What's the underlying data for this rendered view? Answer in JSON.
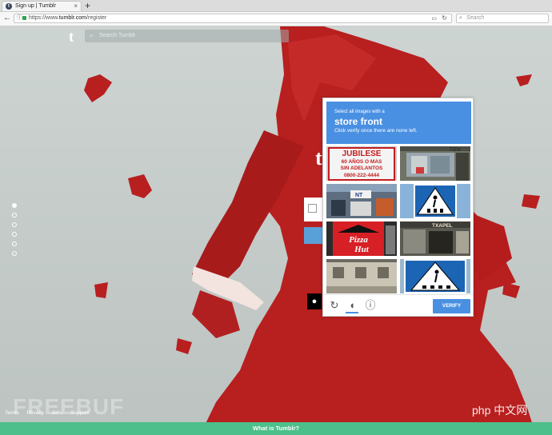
{
  "browser": {
    "tab_title": "Sign up | Tumblr",
    "tab_close": "×",
    "new_tab": "+",
    "back": "←",
    "info": "ⓘ",
    "url_prefix": "https://www.",
    "url_host": "tumblr.com",
    "url_path": "/register",
    "reload": "↻",
    "search_placeholder": "Search"
  },
  "tumblr": {
    "logo": "t",
    "search_placeholder": "Search Tumblr",
    "bg_logo": "t",
    "footer_links": [
      "Terms",
      "Privacy",
      "Jobs",
      "Support"
    ],
    "what_is_tumblr": "What is Tumblr?"
  },
  "captcha": {
    "instruction_top": "Select all images with a",
    "target": "store front",
    "instruction_bottom": "Click verify once there are none left.",
    "tiles": [
      {
        "name": "jubilese-sign",
        "lines": [
          "JUBILESE",
          "60 AÑOS O MAS",
          "SIN ADELANTOS",
          "0800-222-4444"
        ]
      },
      {
        "name": "shop-window",
        "lines": [
          "TIEN"
        ]
      },
      {
        "name": "street-shops",
        "lines": [
          "NT"
        ]
      },
      {
        "name": "crosswalk-sign",
        "lines": []
      },
      {
        "name": "pizza-hut",
        "lines": [
          "Pizza",
          "Hut"
        ]
      },
      {
        "name": "shop-exterior",
        "lines": [
          "TXAPEL"
        ]
      },
      {
        "name": "building",
        "lines": []
      },
      {
        "name": "pedestrian-sign",
        "lines": []
      }
    ],
    "verify_label": "VERIFY"
  },
  "watermarks": {
    "left": "FREEBUF",
    "right": "php 中文网"
  },
  "colors": {
    "accent": "#4a90e2",
    "tumblr_green": "#4dbf8a",
    "dress_red": "#b81f1f"
  }
}
